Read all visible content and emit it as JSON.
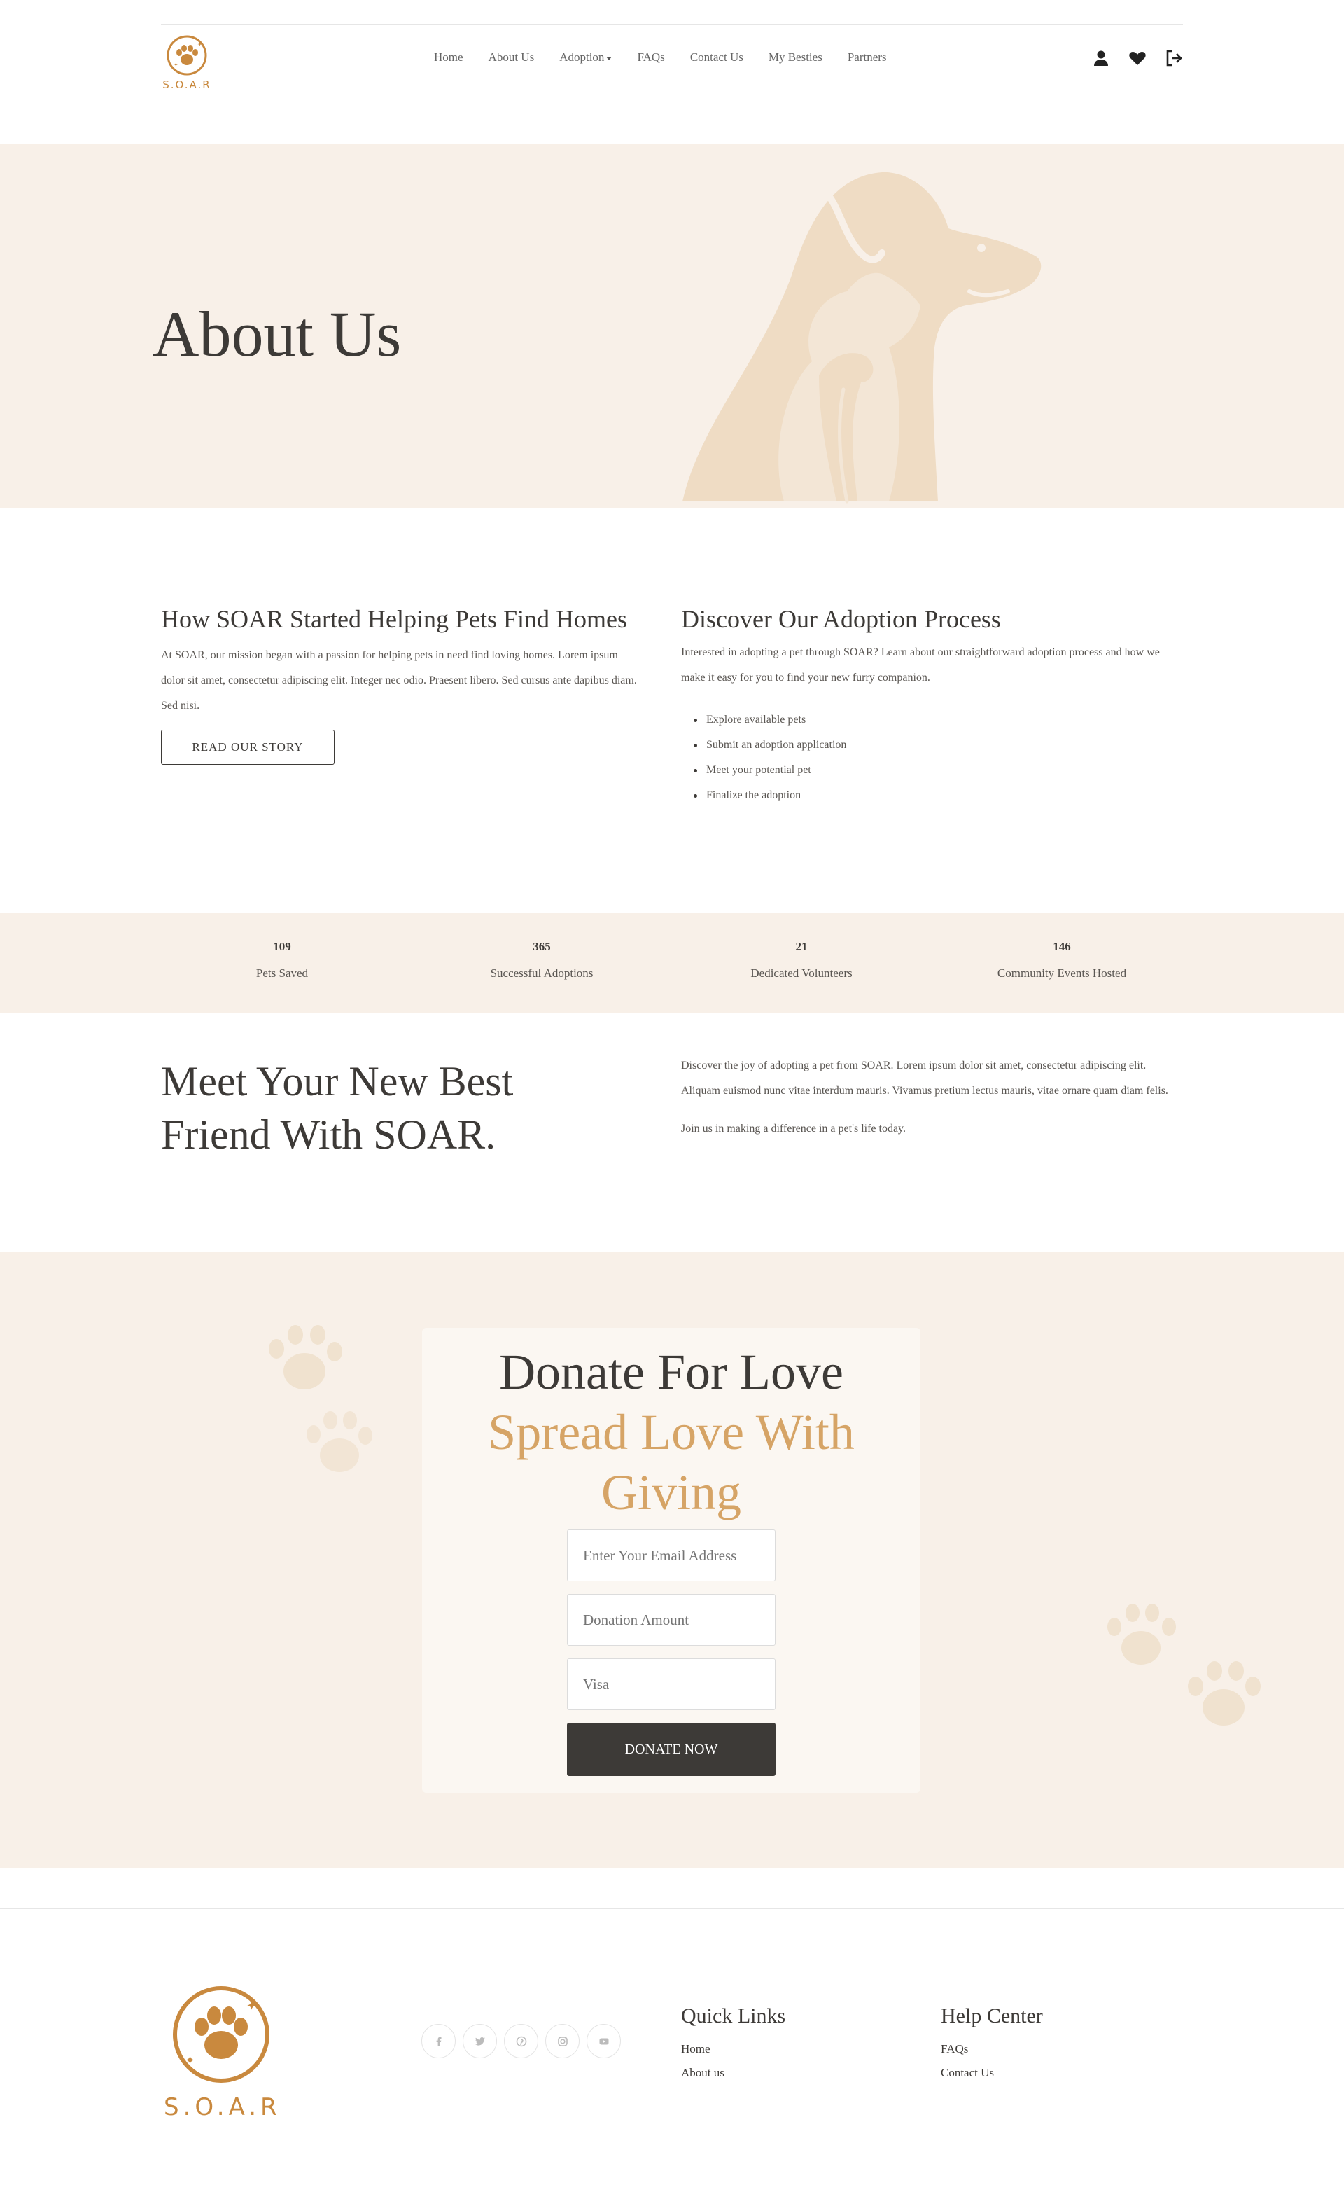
{
  "brand": {
    "logo_text": "S.O.A.R",
    "accent": "#c9893e",
    "cream": "#f8f0e8",
    "dark": "#3d3a37",
    "gold": "#d6a466"
  },
  "nav": {
    "items": [
      {
        "label": "Home"
      },
      {
        "label": "About Us"
      },
      {
        "label": "Adoption"
      },
      {
        "label": "FAQs"
      },
      {
        "label": "Contact Us"
      },
      {
        "label": "My Besties"
      },
      {
        "label": "Partners"
      }
    ],
    "icons": [
      "user-icon",
      "heart-icon",
      "logout-icon"
    ]
  },
  "hero": {
    "title": "About Us"
  },
  "story": {
    "title": "How SOAR Started Helping Pets Find Homes",
    "text": "At SOAR, our mission began with a passion for helping pets in need find loving homes. Lorem ipsum dolor sit amet, consectetur adipiscing elit. Integer nec odio. Praesent libero. Sed cursus ante dapibus diam. Sed nisi.",
    "button": "READ OUR STORY"
  },
  "process": {
    "title": "Discover Our Adoption Process",
    "text": "Interested in adopting a pet through SOAR? Learn about our straightforward adoption process and how we make it easy for you to find your new furry companion.",
    "steps": [
      "Explore available pets",
      "Submit an adoption application",
      "Meet your potential pet",
      "Finalize the adoption"
    ]
  },
  "stats": [
    {
      "value": "109",
      "label": "Pets Saved"
    },
    {
      "value": "365",
      "label": "Successful Adoptions"
    },
    {
      "value": "21",
      "label": "Dedicated Volunteers"
    },
    {
      "value": "146",
      "label": "Community Events Hosted"
    }
  ],
  "meet": {
    "title": "Meet Your New Best Friend With SOAR.",
    "p1": "Discover the joy of adopting a pet from SOAR. Lorem ipsum dolor sit amet, consectetur adipiscing elit. Aliquam euismod nunc vitae interdum mauris. Vivamus pretium lectus mauris, vitae ornare quam diam felis.",
    "p2": "Join us in making a difference in a pet's life today."
  },
  "donate": {
    "title": "Donate For Love",
    "subtitle": "Spread Love With Giving",
    "email_placeholder": "Enter Your Email Address",
    "amount_placeholder": "Donation Amount",
    "card_placeholder": "Visa",
    "button": "DONATE NOW"
  },
  "footer": {
    "socials": [
      "facebook-icon",
      "twitter-icon",
      "pinterest-icon",
      "instagram-icon",
      "youtube-icon"
    ],
    "quick_links": {
      "title": "Quick Links",
      "links": [
        "Home",
        "About us"
      ]
    },
    "help_center": {
      "title": "Help Center",
      "links": [
        "FAQs",
        "Contact Us"
      ]
    }
  }
}
